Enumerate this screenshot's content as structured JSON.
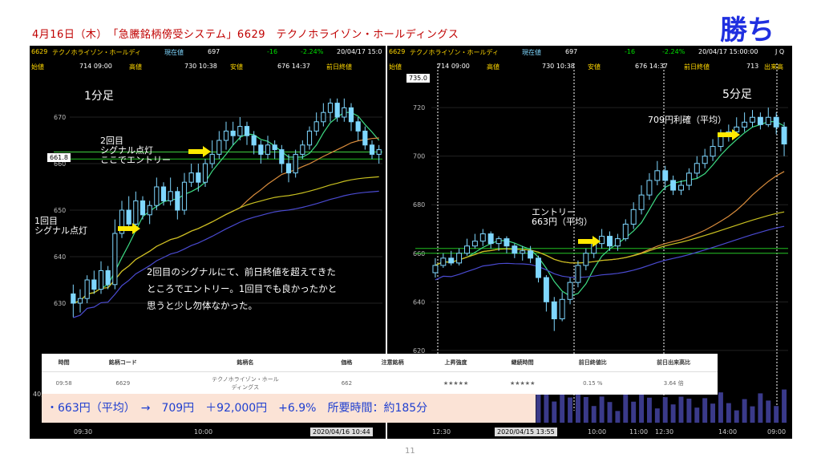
{
  "title": "4月16日（木）　「急騰銘柄傍受システム」6629　テクノホライゾン・ホールディングス",
  "result": "勝ち",
  "page_number": "11",
  "left_chart": {
    "header_row1": {
      "code": "6629",
      "name": "テクノホライゾン・ホールディ",
      "label": "現在値",
      "price": "697",
      "change": "-16",
      "pct": "-2.24%",
      "datetime": "20/04/17 15:0"
    },
    "header_row2": {
      "open_label": "始値",
      "open": "714 09:00",
      "high_label": "高値",
      "high": "730 10:38",
      "low_label": "安値",
      "low": "676 14:37",
      "prev_label": "前日終値"
    },
    "timeframe": "1分足",
    "price_box": "661.8",
    "annotation_second": "2回目\nシグナル点灯\nここでエントリー",
    "annotation_first": "1回目\nシグナル点灯",
    "note_lines": [
      "2回目のシグナルにて、前日終値を超えてきた",
      "ところでエントリー。1回目でも良かったかと",
      "思うと少し勿体なかった。"
    ],
    "time_labels": [
      "09:30",
      "10:00"
    ],
    "time_stamp": "2020/04/16 10:44",
    "volume_axis": "40,000"
  },
  "right_chart": {
    "header_row1": {
      "code": "6629",
      "name": "テクノホライゾン・ホールディ",
      "label": "現在値",
      "price": "697",
      "change": "-16",
      "pct": "-2.24%",
      "datetime": "20/04/17 15:00:00",
      "extra": "J Q"
    },
    "header_row2": {
      "open_label": "始値",
      "open": "714 09:00",
      "high_label": "高値",
      "high": "730 10:38",
      "low_label": "安値",
      "low": "676 14:37",
      "prev_label": "前日終値",
      "prev": "713",
      "vol_label": "出来高"
    },
    "timeframe": "5分足",
    "price_box": "735.0",
    "annotation_profit": "709円利確（平均）",
    "annotation_entry": "エントリー\n663円（平均）",
    "time_labels": [
      "12:30",
      "10:00",
      "11:00",
      "12:30",
      "14:00",
      "09:00"
    ],
    "time_stamp": "2020/04/15 13:55"
  },
  "table": {
    "headers": [
      "時間",
      "銘柄コード",
      "銘柄名",
      "価格",
      "注意銘柄",
      "上昇強度",
      "継続時間",
      "前日終値比",
      "前日出来高比"
    ],
    "row": {
      "time": "09:58",
      "code": "6629",
      "name": "テクノホライゾン・ホール\nディングス",
      "price": "662",
      "caution": "",
      "strength": "★★★★★",
      "duration": "★★★★★",
      "prev_close_ratio": "0.15 %",
      "prev_volume_ratio": "3.64 倍"
    }
  },
  "summary": "・663円（平均）　→　709円　＋92,000円　+6.9%　所要時間：約185分",
  "chart_data": [
    {
      "type": "candlestick",
      "title": "1分足",
      "ylim": [
        625,
        675
      ],
      "yticks": [
        630,
        640,
        650,
        660,
        670
      ],
      "xticks": [
        "09:30",
        "10:00"
      ],
      "lines": [
        {
          "name": "price_box",
          "value": 661.8
        },
        {
          "name": "prev_close_band",
          "values": [
            660.5,
            661.5
          ]
        }
      ],
      "candles": [
        [
          632,
          630,
          634,
          627
        ],
        [
          630,
          631,
          633,
          628
        ],
        [
          631,
          635,
          636,
          630
        ],
        [
          635,
          633,
          637,
          632
        ],
        [
          633,
          637,
          639,
          632
        ],
        [
          637,
          634,
          638,
          633
        ],
        [
          634,
          645,
          648,
          633
        ],
        [
          645,
          650,
          652,
          644
        ],
        [
          650,
          647,
          653,
          646
        ],
        [
          647,
          652,
          654,
          646
        ],
        [
          652,
          649,
          653,
          648
        ],
        [
          649,
          651,
          652,
          647
        ],
        [
          651,
          655,
          657,
          650
        ],
        [
          655,
          652,
          656,
          651
        ],
        [
          652,
          654,
          657,
          651
        ],
        [
          654,
          650,
          655,
          648
        ],
        [
          650,
          656,
          658,
          649
        ],
        [
          656,
          658,
          660,
          655
        ],
        [
          658,
          656,
          660,
          654
        ],
        [
          656,
          660,
          661,
          655
        ],
        [
          660,
          662,
          665,
          659
        ],
        [
          662,
          665,
          667,
          661
        ],
        [
          665,
          667,
          669,
          663
        ],
        [
          667,
          666,
          669,
          664
        ],
        [
          666,
          668,
          670,
          665
        ],
        [
          668,
          666,
          669,
          664
        ],
        [
          666,
          664,
          667,
          662
        ],
        [
          664,
          662,
          665,
          660
        ],
        [
          662,
          664,
          666,
          661
        ],
        [
          664,
          663,
          665,
          661
        ],
        [
          663,
          660,
          664,
          658
        ],
        [
          660,
          658,
          662,
          656
        ],
        [
          658,
          662,
          663,
          657
        ],
        [
          662,
          664,
          665,
          661
        ],
        [
          664,
          667,
          668,
          663
        ],
        [
          667,
          669,
          671,
          666
        ],
        [
          669,
          671,
          673,
          668
        ],
        [
          671,
          673,
          674,
          669
        ],
        [
          673,
          670,
          674,
          669
        ],
        [
          670,
          672,
          674,
          669
        ],
        [
          672,
          669,
          673,
          667
        ],
        [
          669,
          667,
          670,
          665
        ],
        [
          667,
          664,
          668,
          663
        ],
        [
          664,
          662,
          665,
          661
        ],
        [
          662,
          663,
          664,
          660
        ]
      ]
    },
    {
      "type": "candlestick",
      "title": "5分足",
      "ylim": [
        615,
        725
      ],
      "yticks": [
        620,
        640,
        660,
        680,
        700,
        720
      ],
      "xticks": [
        "12:30",
        "10:00",
        "11:00",
        "12:30",
        "14:00",
        "09:00"
      ],
      "lines": [
        {
          "name": "price_box",
          "value": 735.0
        }
      ],
      "candles": [
        [
          652,
          655,
          658,
          650
        ],
        [
          655,
          658,
          660,
          654
        ],
        [
          658,
          656,
          661,
          655
        ],
        [
          656,
          660,
          662,
          655
        ],
        [
          660,
          663,
          666,
          659
        ],
        [
          663,
          665,
          668,
          662
        ],
        [
          665,
          668,
          670,
          663
        ],
        [
          668,
          664,
          669,
          662
        ],
        [
          664,
          666,
          667,
          661
        ],
        [
          666,
          663,
          667,
          660
        ],
        [
          663,
          660,
          664,
          658
        ],
        [
          660,
          661,
          663,
          657
        ],
        [
          661,
          658,
          663,
          656
        ],
        [
          658,
          650,
          659,
          648
        ],
        [
          650,
          640,
          651,
          636
        ],
        [
          640,
          633,
          642,
          628
        ],
        [
          633,
          641,
          644,
          632
        ],
        [
          641,
          648,
          650,
          639
        ],
        [
          648,
          655,
          657,
          646
        ],
        [
          655,
          660,
          662,
          653
        ],
        [
          660,
          664,
          666,
          658
        ],
        [
          664,
          667,
          670,
          662
        ],
        [
          667,
          663,
          669,
          661
        ],
        [
          663,
          666,
          668,
          661
        ],
        [
          666,
          672,
          674,
          665
        ],
        [
          672,
          678,
          681,
          670
        ],
        [
          678,
          684,
          688,
          676
        ],
        [
          684,
          690,
          693,
          682
        ],
        [
          690,
          694,
          698,
          688
        ],
        [
          694,
          690,
          696,
          686
        ],
        [
          690,
          686,
          692,
          684
        ],
        [
          686,
          688,
          690,
          684
        ],
        [
          688,
          693,
          695,
          686
        ],
        [
          693,
          697,
          700,
          691
        ],
        [
          697,
          700,
          703,
          695
        ],
        [
          700,
          704,
          707,
          698
        ],
        [
          704,
          708,
          711,
          702
        ],
        [
          708,
          710,
          713,
          706
        ],
        [
          710,
          712,
          716,
          708
        ],
        [
          712,
          714,
          718,
          710
        ],
        [
          714,
          716,
          719,
          712
        ],
        [
          716,
          713,
          718,
          711
        ],
        [
          713,
          716,
          720,
          712
        ],
        [
          716,
          712,
          718,
          709
        ],
        [
          712,
          705,
          714,
          700
        ]
      ]
    }
  ]
}
